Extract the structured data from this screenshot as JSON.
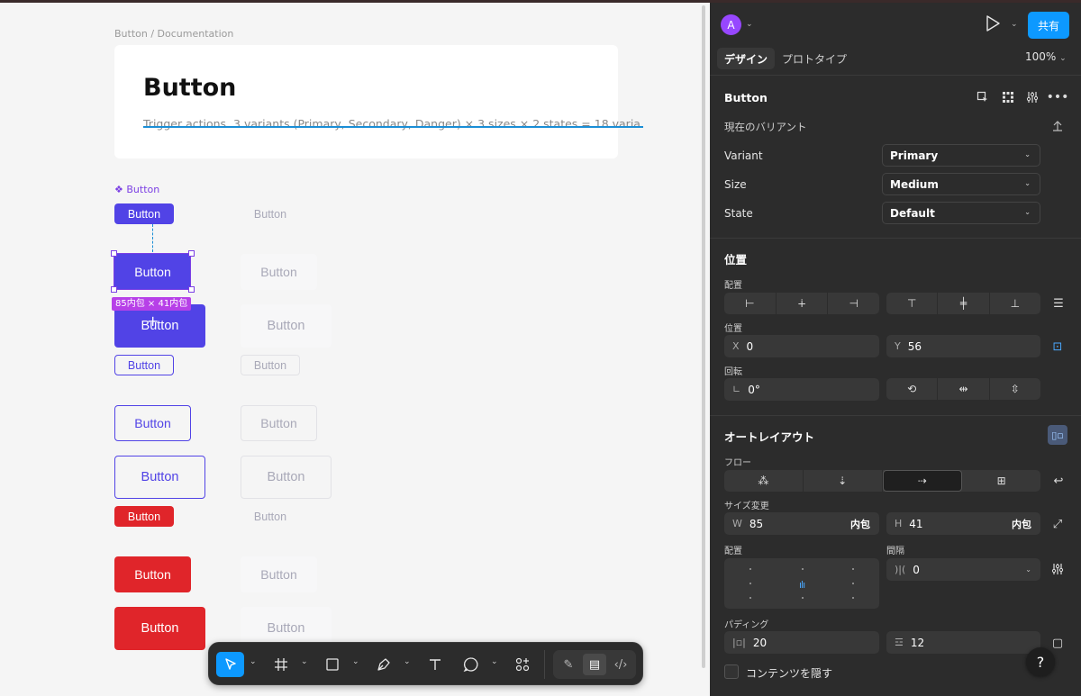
{
  "canvas": {
    "breadcrumb": "Button / Documentation",
    "doc_title": "Button",
    "doc_description": "Trigger actions. 3 variants (Primary, Secondary, Danger) × 3 sizes × 2 states = 18 varia",
    "component_label": "❖ Button",
    "button_label": "Button",
    "size_tag": "85内包 × 41内包",
    "colors": {
      "primary": "#5143e6",
      "danger": "#e0252a",
      "selection": "#7b3fe4",
      "accent": "#0d99ff"
    }
  },
  "toolbar": {
    "tools": [
      {
        "name": "move-tool",
        "icon": "cursor-icon"
      },
      {
        "name": "frame-tool",
        "icon": "frame-icon"
      },
      {
        "name": "rectangle-tool",
        "icon": "rectangle-icon"
      },
      {
        "name": "pen-tool",
        "icon": "pen-icon"
      },
      {
        "name": "text-tool",
        "icon": "text-icon"
      },
      {
        "name": "comment-tool",
        "icon": "comment-icon"
      },
      {
        "name": "components-tool",
        "icon": "components-icon"
      },
      {
        "name": "draw-mode",
        "icon": "draw-icon"
      },
      {
        "name": "design-mode",
        "icon": "design-icon"
      },
      {
        "name": "dev-mode",
        "icon": "code-icon"
      }
    ]
  },
  "panel": {
    "avatar_initial": "A",
    "share_label": "共有",
    "tabs": {
      "design": "デザイン",
      "prototype": "プロトタイプ"
    },
    "zoom": "100%",
    "component": {
      "name": "Button",
      "current_variant_label": "現在のバリアント",
      "properties": [
        {
          "label": "Variant",
          "value": "Primary"
        },
        {
          "label": "Size",
          "value": "Medium"
        },
        {
          "label": "State",
          "value": "Default"
        }
      ]
    },
    "position": {
      "title": "位置",
      "align_label": "配置",
      "position_label": "位置",
      "x_label": "X",
      "x_value": "0",
      "y_label": "Y",
      "y_value": "56",
      "rotation_label": "回転",
      "rotation_value": "0°"
    },
    "auto_layout": {
      "title": "オートレイアウト",
      "flow_label": "フロー",
      "resize_label": "サイズ変更",
      "w_label": "W",
      "w_value": "85",
      "w_mode": "内包",
      "h_label": "H",
      "h_value": "41",
      "h_mode": "内包",
      "alignment_label": "配置",
      "gap_label": "間隔",
      "gap_value": "0",
      "padding_label": "パディング",
      "padding_h": "20",
      "padding_v": "12"
    },
    "hide_content_label": "コンテンツを隠す",
    "help_label": "?"
  }
}
